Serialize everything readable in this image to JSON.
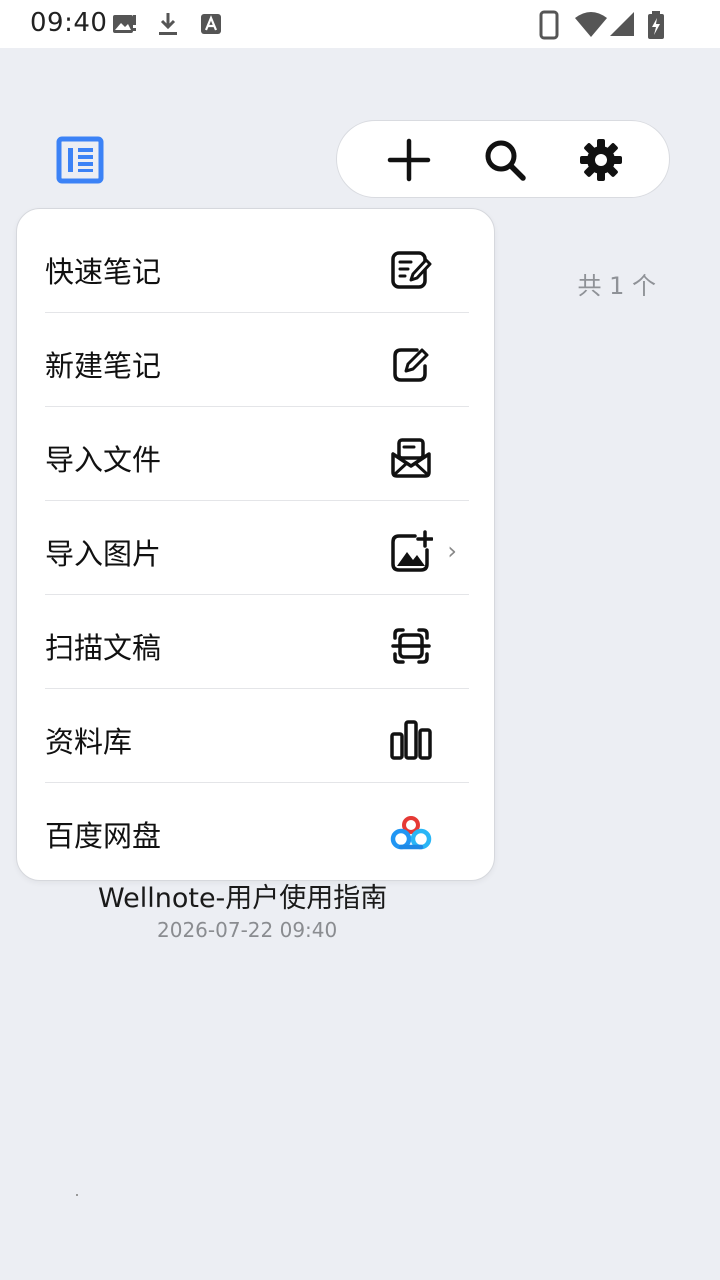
{
  "status_bar": {
    "time": "09:40",
    "icons": [
      "image-icon",
      "download-icon",
      "a-icon",
      "phone-icon",
      "wifi-icon",
      "signal-icon",
      "battery-icon"
    ]
  },
  "header": {
    "sidebar_icon": "sidebar-list-icon",
    "actions": [
      "add-icon",
      "search-icon",
      "gear-icon"
    ]
  },
  "content": {
    "count_label": "共 1 个",
    "note": {
      "title": "Wellnote-用户使用指南",
      "date": "2026-07-22 09:40"
    }
  },
  "menu": {
    "items": [
      {
        "label": "快速笔记",
        "icon": "quick-note-icon"
      },
      {
        "label": "新建笔记",
        "icon": "edit-icon"
      },
      {
        "label": "导入文件",
        "icon": "mail-import-icon"
      },
      {
        "label": "导入图片",
        "icon": "image-add-icon",
        "chevron": "›"
      },
      {
        "label": "扫描文稿",
        "icon": "scan-icon"
      },
      {
        "label": "资料库",
        "icon": "library-icon"
      },
      {
        "label": "百度网盘",
        "icon": "baidu-cloud-icon"
      }
    ]
  },
  "colors": {
    "accent": "#3b82f6",
    "background": "#eceef3"
  }
}
